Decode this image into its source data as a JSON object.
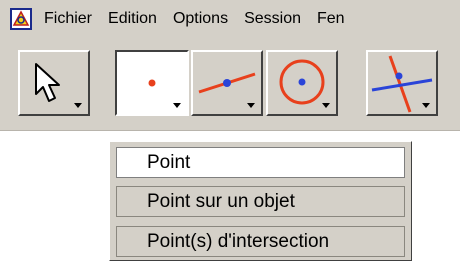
{
  "menubar": {
    "items": [
      "Fichier",
      "Edition",
      "Options",
      "Session",
      "Fen"
    ]
  },
  "toolbar": {
    "tools": [
      {
        "icon": "arrow-pointer-icon"
      },
      {
        "icon": "point-icon",
        "active": true
      },
      {
        "icon": "point-on-line-icon"
      },
      {
        "icon": "point-on-circle-icon"
      },
      {
        "icon": "intersection-point-icon"
      }
    ]
  },
  "dropdown": {
    "items": [
      "Point",
      "Point sur un objet",
      "Point(s) d'intersection"
    ],
    "selected_index": 0
  },
  "colors": {
    "chrome": "#d4d0c8",
    "red": "#e8401c",
    "blue": "#2a44d8"
  }
}
